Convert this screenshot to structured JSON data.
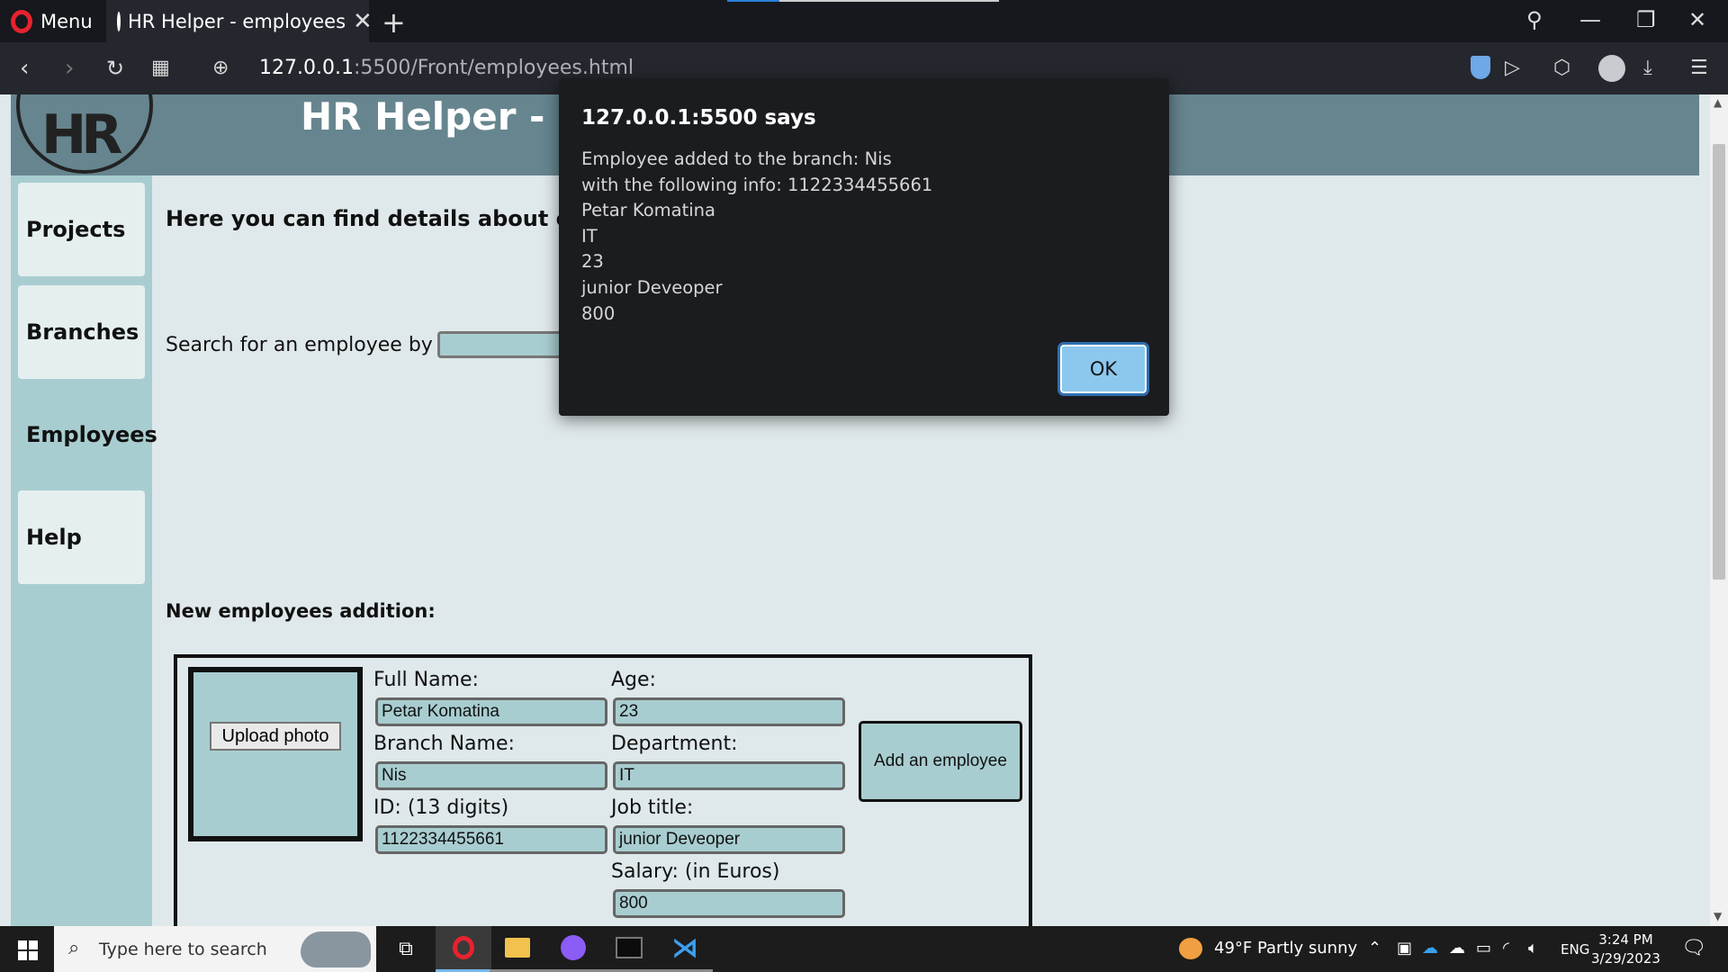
{
  "browser": {
    "menu_label": "Menu",
    "tab_title": "HR Helper - employees",
    "url_host": "127.0.0.1",
    "url_path": ":5500/Front/employees.html"
  },
  "page": {
    "header_title": "HR Helper - Em",
    "logo_text": "HR",
    "sidebar": [
      "Projects",
      "Branches",
      "Employees",
      "Help"
    ],
    "active_section": "Employees",
    "intro": "Here you can find details about emplo",
    "search_label": "Search for an employee by Id:",
    "search_value": "",
    "new_title": "New employees addition:",
    "form": {
      "upload_label": "Upload photo",
      "full_name_label": "Full Name:",
      "full_name_value": "Petar Komatina",
      "age_label": "Age:",
      "age_value": "23",
      "branch_label": "Branch Name:",
      "branch_value": "Nis",
      "department_label": "Department:",
      "department_value": "IT",
      "id_label": "ID: (13 digits)",
      "id_value": "1122334455661",
      "job_label": "Job title:",
      "job_value": "junior Deveoper",
      "salary_label": "Salary: (in Euros)",
      "salary_value": "800",
      "add_label": "Add an employee"
    }
  },
  "dialog": {
    "title": "127.0.0.1:5500 says",
    "lines": [
      "Employee added to the branch: Nis",
      "with the following info: 1122334455661",
      "Petar Komatina",
      "IT",
      "23",
      "junior Deveoper",
      "800"
    ],
    "ok_label": "OK"
  },
  "taskbar": {
    "search_placeholder": "Type here to search",
    "weather": "49°F  Partly sunny",
    "language": "ENG",
    "time": "3:24 PM",
    "date": "3/29/2023"
  },
  "colors": {
    "header": "#66858f",
    "sidebar": "#a8cdd0",
    "page_bg": "#dfe8eb",
    "dialog_bg": "#1b1c20",
    "ok_button": "#8cc8ee"
  }
}
